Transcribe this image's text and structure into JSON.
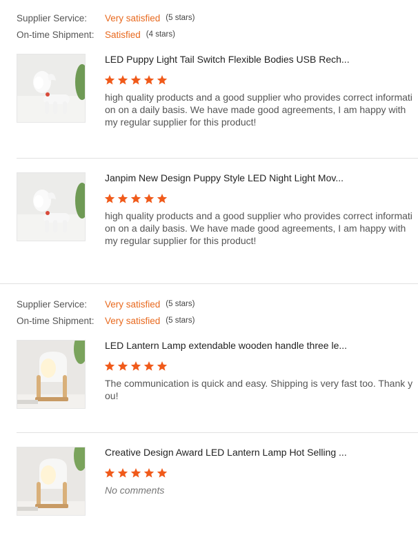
{
  "colors": {
    "accent": "#e8691e",
    "star": "#f05a1a"
  },
  "reviews": [
    {
      "ratings": [
        {
          "label": "Supplier Service:",
          "value": "Very satisfied",
          "count": "(5 stars)"
        },
        {
          "label": "On-time Shipment:",
          "value": "Satisfied",
          "count": "(4 stars)"
        }
      ],
      "products": [
        {
          "image": "puppy-lamp-image",
          "title": "LED Puppy Light Tail Switch Flexible Bodies USB Rech...",
          "stars": 5,
          "comment": "high quality products and a good supplier who provides correct information on a daily basis. We have made good agreements, I am happy with my regular supplier for this product!"
        },
        {
          "image": "puppy-lamp-image",
          "title": "Janpim New Design Puppy Style LED Night Light Mov...",
          "stars": 5,
          "comment": "high quality products and a good supplier who provides correct information on a daily basis. We have made good agreements, I am happy with my regular supplier for this product!"
        }
      ]
    },
    {
      "ratings": [
        {
          "label": "Supplier Service:",
          "value": "Very satisfied",
          "count": "(5 stars)"
        },
        {
          "label": "On-time Shipment:",
          "value": "Very satisfied",
          "count": "(5 stars)"
        }
      ],
      "products": [
        {
          "image": "lantern-lamp-image",
          "title": "LED Lantern Lamp extendable wooden handle three le...",
          "stars": 5,
          "comment": "The communication is quick and easy. Shipping is very fast too. Thank you!"
        },
        {
          "image": "lantern-lamp-image",
          "title": "Creative Design Award LED Lantern Lamp Hot Selling ...",
          "stars": 5,
          "comment": "No comments"
        }
      ]
    }
  ]
}
